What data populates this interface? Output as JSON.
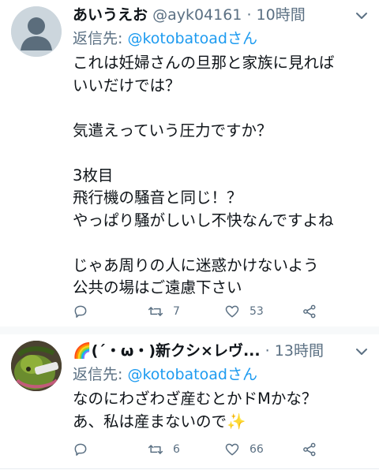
{
  "tweets": [
    {
      "name": "あいうえお",
      "handle": "@ayk04161",
      "dot": "·",
      "time": "10時間",
      "reply_prefix": "返信先: ",
      "reply_mention": "@kotobatoad",
      "reply_suffix": "さん",
      "body": "これは妊婦さんの旦那と家族に見れば\nいいだけでは？\n\n気遣えっていう圧力ですか？\n\n3枚目\n飛行機の騒音と同じ！？\nやっぱり騒がしいし不快なんですよね\n\nじゃあ周りの人に迷惑かけないよう\n公共の場はご遠慮下さい",
      "actions": {
        "reply_icon": "reply-icon",
        "retweet_count": "7",
        "like_count": "53",
        "share_icon": "share-icon"
      }
    },
    {
      "name": "🌈(´・ω・)新クシ×レヴ...",
      "handle": "",
      "dot": "·",
      "time": "13時間",
      "reply_prefix": "返信先: ",
      "reply_mention": "@kotobatoad",
      "reply_suffix": "さん",
      "body": "なのにわざわざ産むとかドMかな？\nあ、私は産まないので✨",
      "actions": {
        "reply_icon": "reply-icon",
        "retweet_count": "6",
        "like_count": "66",
        "share_icon": "share-icon"
      }
    }
  ],
  "colors": {
    "accent": "#1d9bf0",
    "muted": "#5b7083",
    "text": "#0f1419"
  }
}
